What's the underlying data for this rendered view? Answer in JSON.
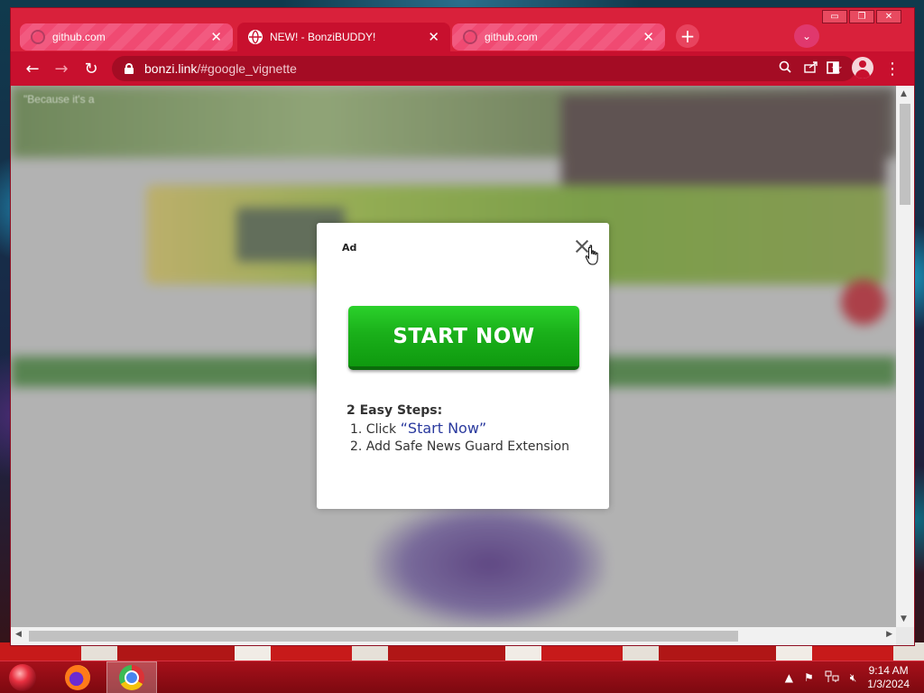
{
  "browser": {
    "tabs": [
      {
        "title": "github.com",
        "active": false
      },
      {
        "title": "NEW! - BonziBUDDY!",
        "active": true
      },
      {
        "title": "github.com",
        "active": false
      }
    ],
    "close_glyph": "✕",
    "new_tab_glyph": "+",
    "window_controls": {
      "minimize": "▭",
      "restore": "❐",
      "close": "✕"
    },
    "url": {
      "host": "bonzi.link",
      "path": "/#google_vignette"
    },
    "accent_color": "#c8102e"
  },
  "page": {
    "quote_fragment": "\"Because it's a"
  },
  "ad": {
    "label": "Ad",
    "button_label": "START NOW",
    "steps_title": "2 Easy Steps:",
    "step1_prefix": "1. Click ",
    "step1_highlight": "“Start Now”",
    "step2": "2. Add Safe News Guard Extension",
    "button_color": "#1ab01a"
  },
  "taskbar": {
    "time": "9:14 AM",
    "date": "1/3/2024",
    "apps": [
      "firefox-icon",
      "chrome-icon"
    ]
  }
}
